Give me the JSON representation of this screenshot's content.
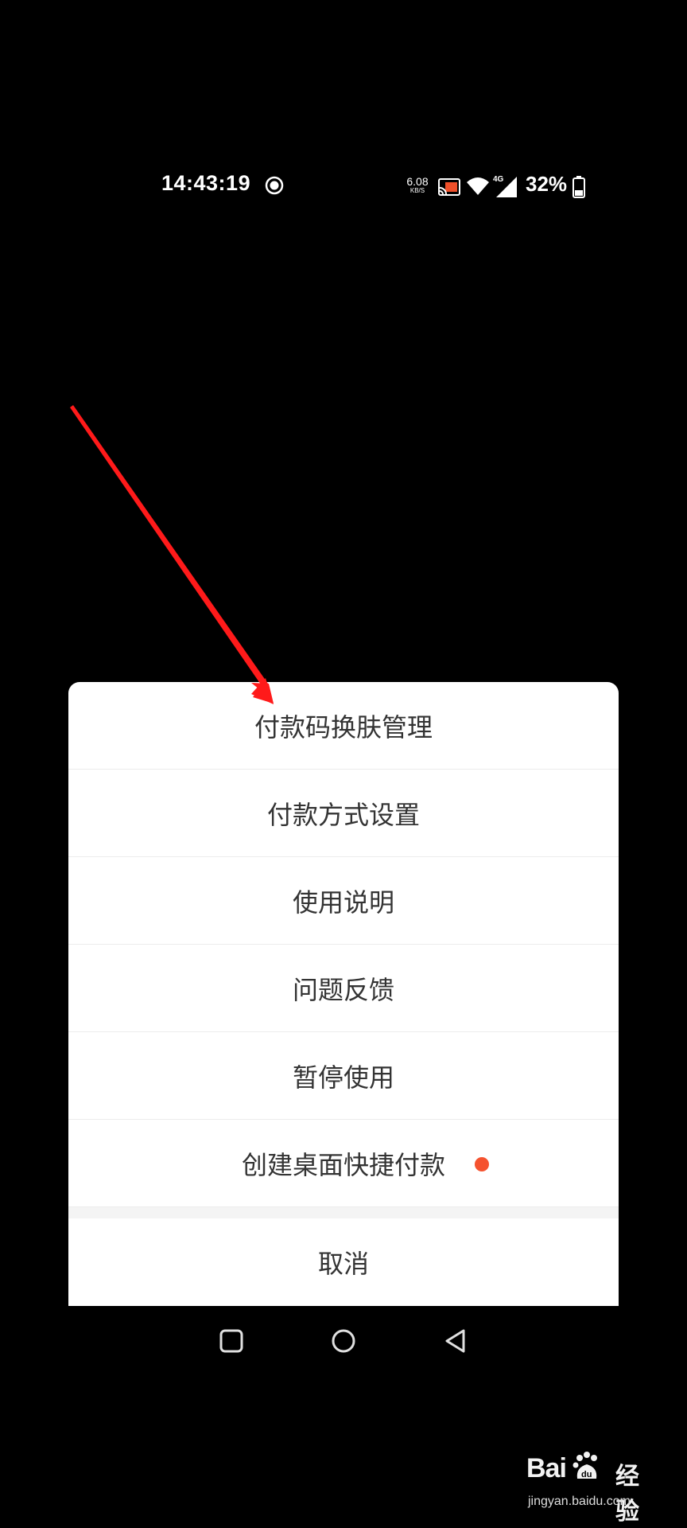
{
  "status_bar": {
    "time": "14:43:19",
    "net_speed_value": "6.08",
    "net_speed_unit": "KB/S",
    "network_type": "4G",
    "battery": "32%",
    "icons": [
      "record-icon",
      "cast-icon",
      "wifi-icon",
      "signal-icon",
      "battery-icon"
    ]
  },
  "action_sheet": {
    "items": [
      {
        "label": "付款码换肤管理"
      },
      {
        "label": "付款方式设置"
      },
      {
        "label": "使用说明"
      },
      {
        "label": "问题反馈"
      },
      {
        "label": "暂停使用"
      },
      {
        "label": "创建桌面快捷付款",
        "badge": true
      }
    ],
    "cancel": "取消"
  },
  "nav_bar": {
    "icons": [
      "recent-apps-icon",
      "home-icon",
      "back-icon"
    ]
  },
  "watermark": {
    "brand": "Bai",
    "brand_suffix": "经验",
    "url": "jingyan.baidu.com"
  },
  "colors": {
    "background": "#000000",
    "sheet": "#ffffff",
    "text": "#333333",
    "badge": "#f5522f",
    "arrow": "#ff1a1a"
  }
}
